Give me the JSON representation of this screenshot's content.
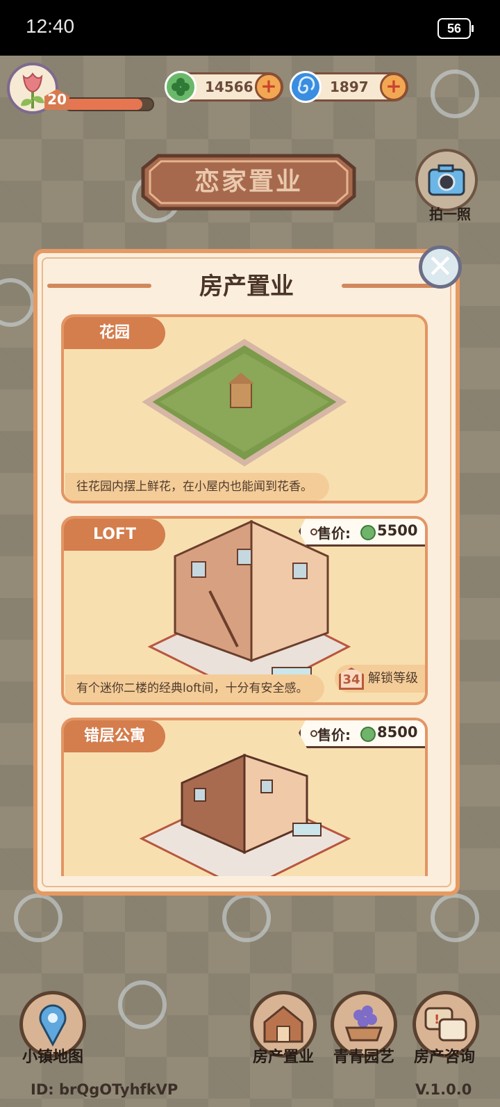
{
  "status_bar": {
    "time": "12:40",
    "battery": "56"
  },
  "player": {
    "level": "20",
    "xp_fraction": 0.88
  },
  "currencies": [
    {
      "name": "clover",
      "value": "14566",
      "icon": "clover-coin-icon",
      "color": "#6ab86a"
    },
    {
      "name": "swirl",
      "value": "1897",
      "icon": "blue-swirl-gem-icon",
      "color": "#3a8de0"
    }
  ],
  "header": {
    "title": "恋家置业",
    "camera_label": "拍一照"
  },
  "panel": {
    "title": "房产置业",
    "price_label": "售价:",
    "unlock_label": "解锁等级",
    "cards": [
      {
        "name": "花园",
        "desc": "往花园内摆上鲜花，在小屋内也能闻到花香。",
        "price": "",
        "unlock_level": ""
      },
      {
        "name": "LOFT",
        "desc": "有个迷你二楼的经典loft间，十分有安全感。",
        "price": "5500",
        "unlock_level": "34"
      },
      {
        "name": "错层公寓",
        "desc": "",
        "price": "8500",
        "unlock_level": ""
      }
    ]
  },
  "bottom_nav": {
    "map": "小镇地图",
    "property": "房产置业",
    "garden": "青青园艺",
    "consult": "房产咨询"
  },
  "footer": {
    "user_id": "ID:  brQgOTyhfkVP",
    "version": "V.1.0.0"
  },
  "colors": {
    "accent": "#e59a63",
    "panel_bg": "#fbeedd",
    "card_bg": "#f8dfb0",
    "tab": "#d47d4d"
  }
}
